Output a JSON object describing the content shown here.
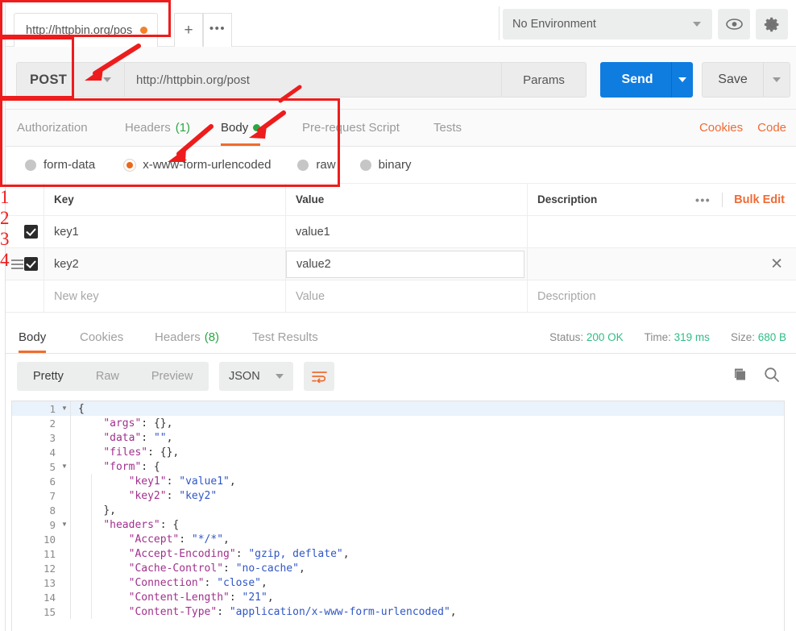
{
  "window": {
    "tab": {
      "title": "http://httpbin.org/pos",
      "unsaved_icon": "unsaved-dot"
    },
    "new_tab_icon": "plus-icon",
    "tab_more_icon": "ellipsis-icon"
  },
  "environment": {
    "selected": "No Environment",
    "eye_icon": "eye-icon",
    "settings_icon": "gear-icon"
  },
  "request": {
    "method": "POST",
    "url": "http://httpbin.org/post",
    "params_label": "Params",
    "send_label": "Send",
    "save_label": "Save"
  },
  "request_tabs": [
    {
      "label": "Authorization",
      "active": false
    },
    {
      "label": "Headers",
      "count": "(1)",
      "active": false
    },
    {
      "label": "Body",
      "active": true,
      "dot": "green-dot"
    },
    {
      "label": "Pre-request Script",
      "active": false
    },
    {
      "label": "Tests",
      "active": false
    }
  ],
  "links": {
    "cookies": "Cookies",
    "code": "Code"
  },
  "body_types": [
    {
      "label": "form-data",
      "selected": false
    },
    {
      "label": "x-www-form-urlencoded",
      "selected": true
    },
    {
      "label": "raw",
      "selected": false
    },
    {
      "label": "binary",
      "selected": false
    }
  ],
  "kv_table": {
    "headers": {
      "key": "Key",
      "value": "Value",
      "description": "Description"
    },
    "more_icon": "ellipsis-icon",
    "bulk_edit": "Bulk Edit",
    "rows": [
      {
        "checked": true,
        "key": "key1",
        "value": "value1",
        "description": ""
      },
      {
        "checked": true,
        "key": "key2",
        "value": "value2",
        "description": "",
        "drag_icon": "drag-handle-icon",
        "close_icon": "close-icon"
      }
    ],
    "new_row": {
      "key": "New key",
      "value": "Value",
      "description": "Description"
    }
  },
  "response_tabs": [
    {
      "label": "Body",
      "active": true
    },
    {
      "label": "Cookies",
      "active": false
    },
    {
      "label": "Headers",
      "count": "(8)",
      "active": false
    },
    {
      "label": "Test Results",
      "active": false
    }
  ],
  "response_meta": {
    "status_label": "Status:",
    "status_value": "200 OK",
    "time_label": "Time:",
    "time_value": "319 ms",
    "size_label": "Size:",
    "size_value": "680 B"
  },
  "response_toolbar": {
    "views": [
      {
        "label": "Pretty",
        "active": true
      },
      {
        "label": "Raw",
        "active": false
      },
      {
        "label": "Preview",
        "active": false
      }
    ],
    "format": "JSON",
    "wrap_icon": "word-wrap-icon",
    "copy_icon": "copy-icon",
    "search_icon": "search-icon"
  },
  "response_body": {
    "lines": [
      {
        "n": "1",
        "fold": true,
        "indent": 0,
        "segs": [
          {
            "t": "{",
            "c": "p"
          }
        ]
      },
      {
        "n": "2",
        "fold": false,
        "indent": 1,
        "segs": [
          {
            "t": "\"args\"",
            "c": "k"
          },
          {
            "t": ": ",
            "c": "p"
          },
          {
            "t": "{},",
            "c": "p"
          }
        ]
      },
      {
        "n": "3",
        "fold": false,
        "indent": 1,
        "segs": [
          {
            "t": "\"data\"",
            "c": "k"
          },
          {
            "t": ": ",
            "c": "p"
          },
          {
            "t": "\"\"",
            "c": "v"
          },
          {
            "t": ",",
            "c": "p"
          }
        ]
      },
      {
        "n": "4",
        "fold": false,
        "indent": 1,
        "segs": [
          {
            "t": "\"files\"",
            "c": "k"
          },
          {
            "t": ": ",
            "c": "p"
          },
          {
            "t": "{},",
            "c": "p"
          }
        ]
      },
      {
        "n": "5",
        "fold": true,
        "indent": 1,
        "segs": [
          {
            "t": "\"form\"",
            "c": "k"
          },
          {
            "t": ": {",
            "c": "p"
          }
        ]
      },
      {
        "n": "6",
        "fold": false,
        "indent": 2,
        "segs": [
          {
            "t": "\"key1\"",
            "c": "k"
          },
          {
            "t": ": ",
            "c": "p"
          },
          {
            "t": "\"value1\"",
            "c": "v"
          },
          {
            "t": ",",
            "c": "p"
          }
        ]
      },
      {
        "n": "7",
        "fold": false,
        "indent": 2,
        "segs": [
          {
            "t": "\"key2\"",
            "c": "k"
          },
          {
            "t": ": ",
            "c": "p"
          },
          {
            "t": "\"key2\"",
            "c": "v"
          }
        ]
      },
      {
        "n": "8",
        "fold": false,
        "indent": 1,
        "segs": [
          {
            "t": "},",
            "c": "p"
          }
        ]
      },
      {
        "n": "9",
        "fold": true,
        "indent": 1,
        "segs": [
          {
            "t": "\"headers\"",
            "c": "k"
          },
          {
            "t": ": {",
            "c": "p"
          }
        ]
      },
      {
        "n": "10",
        "fold": false,
        "indent": 2,
        "segs": [
          {
            "t": "\"Accept\"",
            "c": "k"
          },
          {
            "t": ": ",
            "c": "p"
          },
          {
            "t": "\"*/*\"",
            "c": "v"
          },
          {
            "t": ",",
            "c": "p"
          }
        ]
      },
      {
        "n": "11",
        "fold": false,
        "indent": 2,
        "segs": [
          {
            "t": "\"Accept-Encoding\"",
            "c": "k"
          },
          {
            "t": ": ",
            "c": "p"
          },
          {
            "t": "\"gzip, deflate\"",
            "c": "v"
          },
          {
            "t": ",",
            "c": "p"
          }
        ]
      },
      {
        "n": "12",
        "fold": false,
        "indent": 2,
        "segs": [
          {
            "t": "\"Cache-Control\"",
            "c": "k"
          },
          {
            "t": ": ",
            "c": "p"
          },
          {
            "t": "\"no-cache\"",
            "c": "v"
          },
          {
            "t": ",",
            "c": "p"
          }
        ]
      },
      {
        "n": "13",
        "fold": false,
        "indent": 2,
        "segs": [
          {
            "t": "\"Connection\"",
            "c": "k"
          },
          {
            "t": ": ",
            "c": "p"
          },
          {
            "t": "\"close\"",
            "c": "v"
          },
          {
            "t": ",",
            "c": "p"
          }
        ]
      },
      {
        "n": "14",
        "fold": false,
        "indent": 2,
        "segs": [
          {
            "t": "\"Content-Length\"",
            "c": "k"
          },
          {
            "t": ": ",
            "c": "p"
          },
          {
            "t": "\"21\"",
            "c": "v"
          },
          {
            "t": ",",
            "c": "p"
          }
        ]
      },
      {
        "n": "15",
        "fold": false,
        "indent": 2,
        "segs": [
          {
            "t": "\"Content-Type\"",
            "c": "k"
          },
          {
            "t": ": ",
            "c": "p"
          },
          {
            "t": "\"application/x-www-form-urlencoded\"",
            "c": "v"
          },
          {
            "t": ",",
            "c": "p"
          }
        ]
      }
    ]
  },
  "annotations": {
    "color": "#ee1c1c",
    "markers": [
      {
        "id": "1",
        "label": "1"
      },
      {
        "id": "2",
        "label": "2"
      },
      {
        "id": "3",
        "label": "3"
      },
      {
        "id": "4",
        "label": "4"
      }
    ]
  }
}
